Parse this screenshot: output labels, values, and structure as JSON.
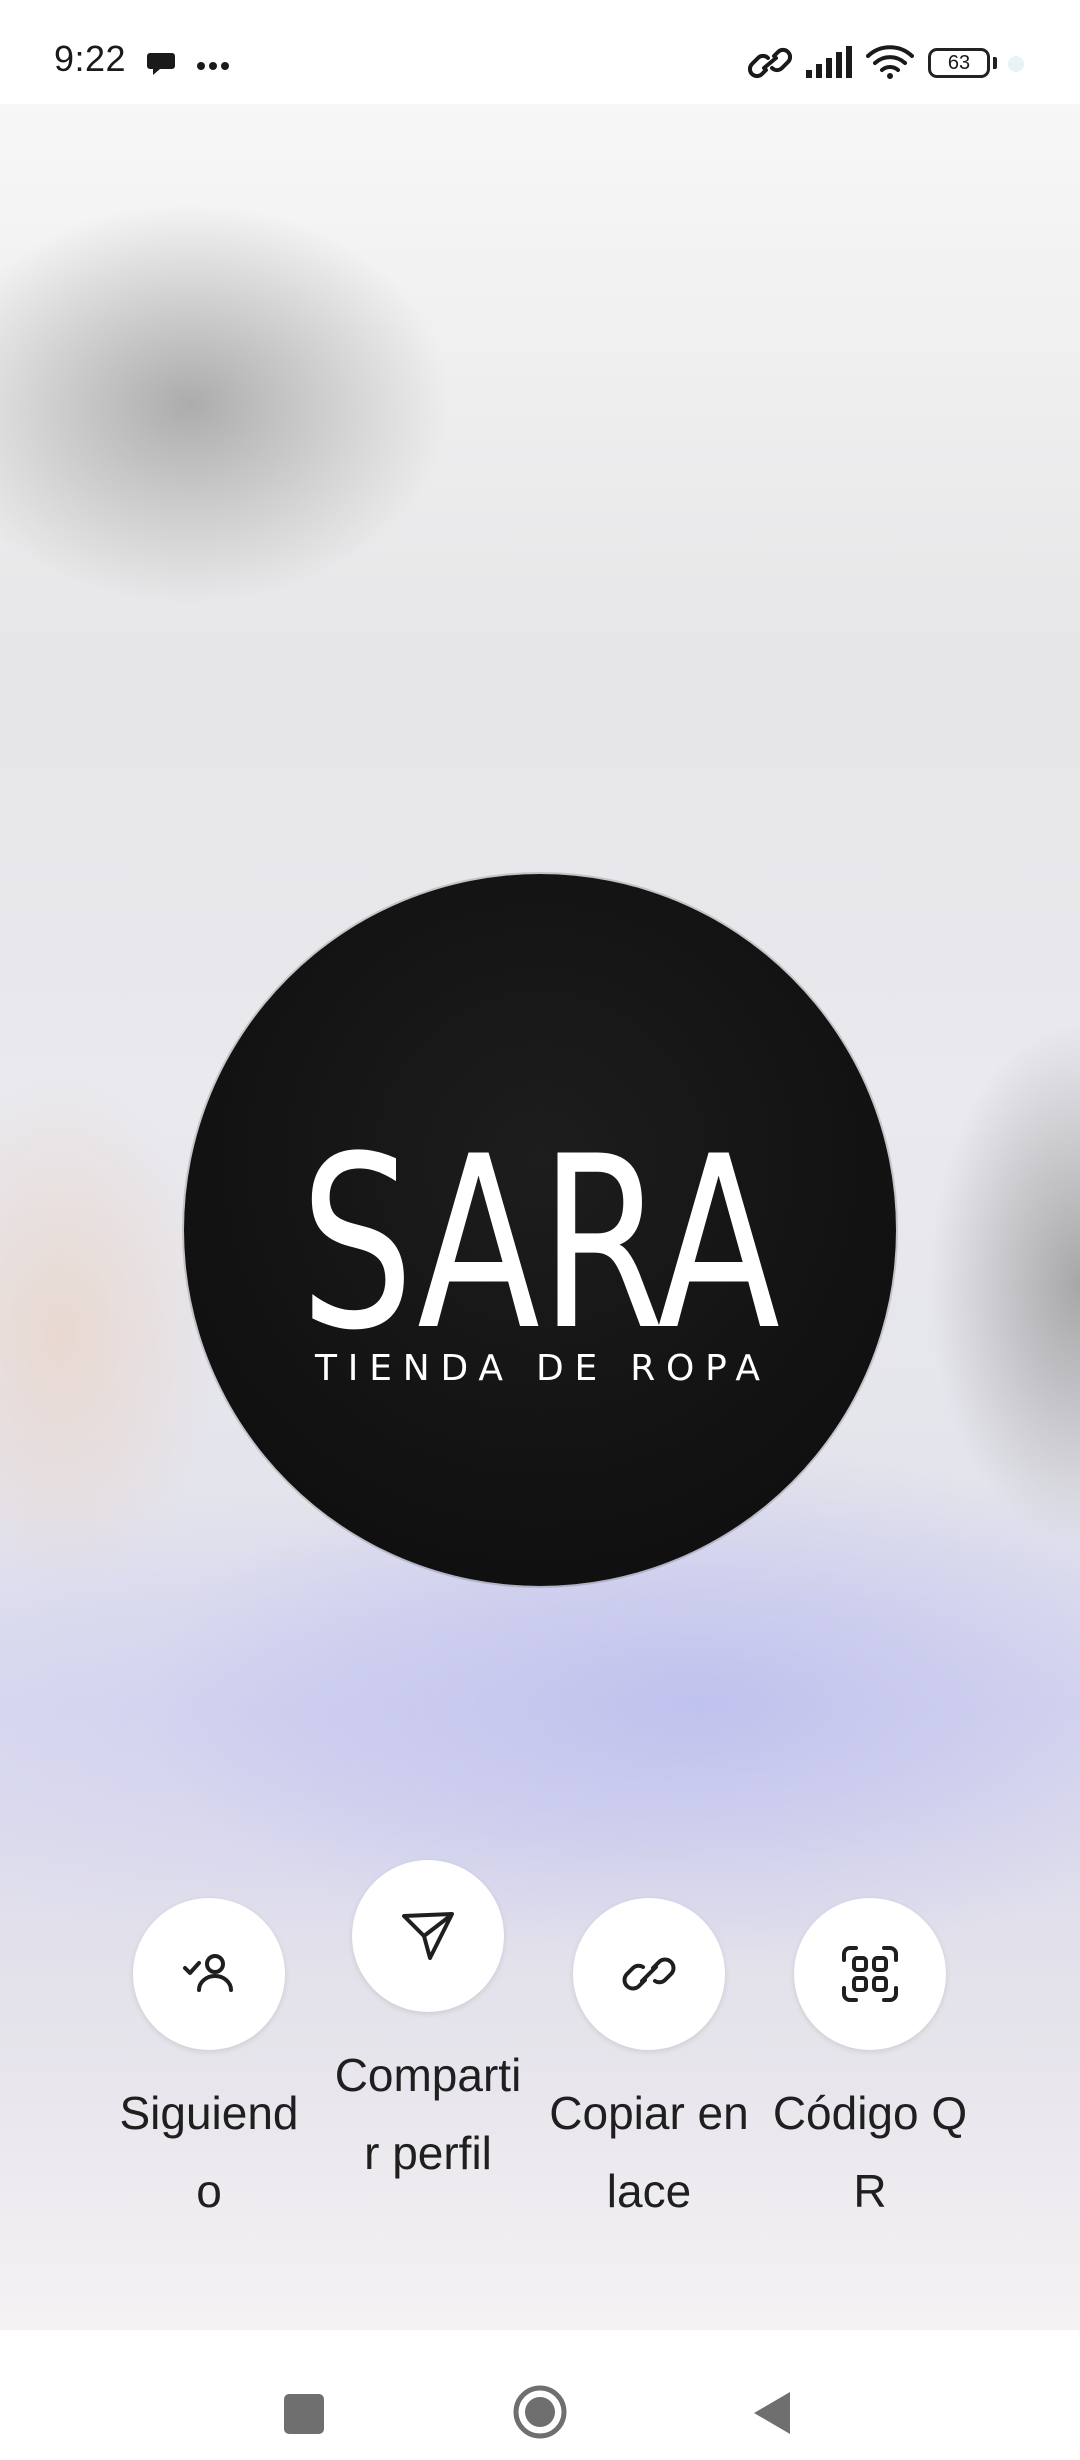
{
  "status_bar": {
    "time": "9:22",
    "battery": "63",
    "icons": [
      "message-icon",
      "more-dots-icon",
      "link-icon",
      "signal-icon",
      "wifi-icon",
      "battery-icon"
    ]
  },
  "profile_logo": {
    "brand": "SARA",
    "tagline": "TIENDA DE ROPA"
  },
  "actions": [
    {
      "label": "Siguiendo",
      "icon": "person-check-icon"
    },
    {
      "label": "Compartir perfil",
      "icon": "send-icon"
    },
    {
      "label": "Copiar enlace",
      "icon": "link-icon"
    },
    {
      "label": "Código QR",
      "icon": "qr-code-icon"
    }
  ],
  "nav_bar": {
    "icons": [
      "recents-square-icon",
      "home-circle-icon",
      "back-triangle-icon"
    ]
  },
  "colors": {
    "logo_background": "#121212",
    "logo_text": "#ffffff",
    "button_background": "#ffffff",
    "icon_color": "#1f1f1f"
  }
}
